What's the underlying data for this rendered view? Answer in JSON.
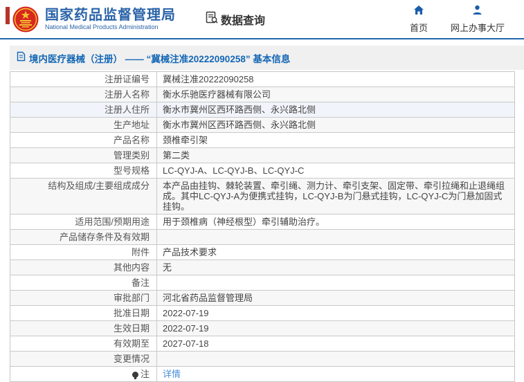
{
  "header": {
    "agency_cn": "国家药品监督管理局",
    "agency_en": "National Medical Products Administration",
    "nav_data_query": "数据查询",
    "nav_home": "首页",
    "nav_service_hall": "网上办事大厅"
  },
  "breadcrumb": {
    "text": "境内医疗器械（注册） —— “冀械注准20222090258” 基本信息"
  },
  "table": {
    "rows": [
      {
        "label": "注册证编号",
        "value": "冀械注准20222090258"
      },
      {
        "label": "注册人名称",
        "value": "衡水乐驰医疗器械有限公司"
      },
      {
        "label": "注册人住所",
        "value": "衡水市冀州区西环路西侧、永兴路北侧"
      },
      {
        "label": "生产地址",
        "value": "衡水市冀州区西环路西侧、永兴路北侧"
      },
      {
        "label": "产品名称",
        "value": "颈椎牵引架"
      },
      {
        "label": "管理类别",
        "value": "第二类"
      },
      {
        "label": "型号规格",
        "value": "LC-QYJ-A、LC-QYJ-B、LC-QYJ-C"
      },
      {
        "label": "结构及组成/主要组成成分",
        "value": "本产品由挂钩、棘轮装置、牵引绳、测力计、牵引支架、固定带、牵引拉绳和止退绳组成。其中LC-QYJ-A为便携式挂钩，LC-QYJ-B为门悬式挂钩，LC-QYJ-C为门悬加固式挂钩。"
      },
      {
        "label": "适用范围/预期用途",
        "value": "用于颈椎病（神经根型）牵引辅助治疗。"
      },
      {
        "label": "产品储存条件及有效期",
        "value": ""
      },
      {
        "label": "附件",
        "value": "产品技术要求"
      },
      {
        "label": "其他内容",
        "value": "无"
      },
      {
        "label": "备注",
        "value": ""
      },
      {
        "label": "审批部门",
        "value": "河北省药品监督管理局"
      },
      {
        "label": "批准日期",
        "value": "2022-07-19"
      },
      {
        "label": "生效日期",
        "value": "2022-07-19"
      },
      {
        "label": "有效期至",
        "value": "2027-07-18"
      },
      {
        "label": "变更情况",
        "value": ""
      },
      {
        "label": "注",
        "value": "详情",
        "value_is_link": true,
        "label_icon": "bulb-icon"
      }
    ]
  },
  "icons": {
    "emblem": "national-emblem-icon",
    "data_query": "document-search-icon",
    "home": "home-icon",
    "service_hall": "person-icon",
    "breadcrumb": "document-icon",
    "note": "bulb-icon"
  },
  "colors": {
    "accent_blue": "#2a63a8",
    "header_border": "#2166ad",
    "breadcrumb_text": "#1467b5",
    "breadcrumb_bg": "#f0f0f0",
    "link_blue": "#4a90d9",
    "emblem_red": "#d6281e",
    "emblem_gold": "#f5c332",
    "row_shade": "#f7f7f7",
    "row_tint": "#f1f4fa",
    "table_border": "#c9c9c9"
  }
}
